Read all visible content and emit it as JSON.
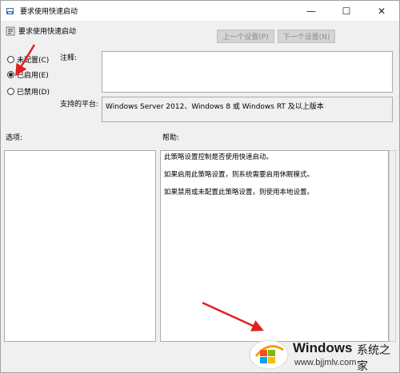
{
  "window": {
    "title": "要求使用快速启动",
    "minimize_glyph": "—",
    "maximize_glyph": "☐",
    "close_glyph": "✕"
  },
  "header": {
    "policy_name": "要求使用快速启动",
    "prev_button": "上一个设置(P)",
    "next_button": "下一个设置(N)"
  },
  "state": {
    "options": [
      {
        "label": "未配置(C)",
        "selected": false
      },
      {
        "label": "已启用(E)",
        "selected": true
      },
      {
        "label": "已禁用(D)",
        "selected": false
      }
    ]
  },
  "comment": {
    "label": "注释:",
    "value": ""
  },
  "platform": {
    "label": "支持的平台:",
    "value": "Windows Server 2012、Windows 8 或 Windows RT 及以上版本"
  },
  "options_section": {
    "label": "选项:"
  },
  "help_section": {
    "label": "帮助:",
    "paragraphs": [
      "此策略设置控制是否使用快速启动。",
      "如果启用此策略设置，则系统需要启用休眠模式。",
      "如果禁用或未配置此策略设置，则使用本地设置。"
    ]
  },
  "watermark": {
    "brand": "Windows",
    "brand_cn": "系统之家",
    "url": "www.bjjmlv.com"
  },
  "colors": {
    "arrow": "#e02020",
    "window_bg": "#f0f0f0"
  }
}
